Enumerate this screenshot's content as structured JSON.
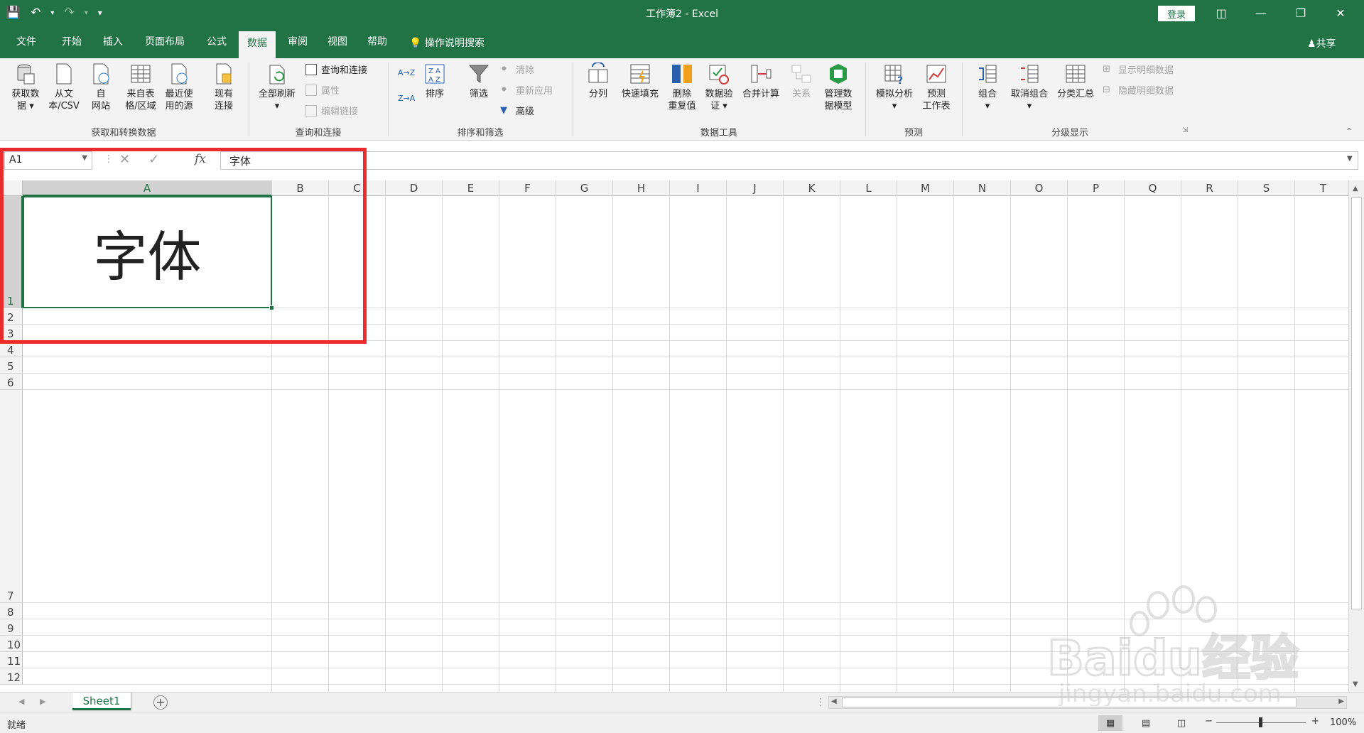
{
  "window": {
    "title": "工作簿2  -  Excel",
    "login_label": "登录",
    "share_label": "共享"
  },
  "tabs": [
    "文件",
    "开始",
    "插入",
    "页面布局",
    "公式",
    "数据",
    "审阅",
    "视图",
    "帮助"
  ],
  "tellme": "操作说明搜索",
  "ribbon": {
    "get_data": "获取数\n据 ▾",
    "from_text": "从文\n本/CSV",
    "from_web": "自\n网站",
    "from_table": "来自表\n格/区域",
    "recent_sources": "最近使\n用的源",
    "existing_conn": "现有\n连接",
    "group1": "获取和转换数据",
    "refresh_all": "全部刷新\n▾",
    "queries_conn": "查询和连接",
    "properties": "属性",
    "edit_links": "编辑链接",
    "group2": "查询和连接",
    "sort_az": "A→Z",
    "sort_za": "Z→A",
    "sort": "排序",
    "filter": "筛选",
    "clear": "清除",
    "reapply": "重新应用",
    "advanced": "高级",
    "group3": "排序和筛选",
    "text_to_col": "分列",
    "flash_fill": "快速填充",
    "remove_dup": "删除\n重复值",
    "validation": "数据验\n证 ▾",
    "consolidate": "合并计算",
    "relations": "关系",
    "manage_model": "管理数\n据模型",
    "group4": "数据工具",
    "what_if": "模拟分析\n▾",
    "forecast": "预测\n工作表",
    "group5": "预测",
    "group_btn": "组合\n▾",
    "ungroup": "取消组合\n▾",
    "subtotal": "分类汇总",
    "show_detail": "显示明细数据",
    "hide_detail": "隐藏明细数据",
    "group6": "分级显示"
  },
  "formula_bar": {
    "name_box": "A1",
    "fx": "fx",
    "content": "字体"
  },
  "columns": [
    "A",
    "B",
    "C",
    "D",
    "E",
    "F",
    "G",
    "H",
    "I",
    "J",
    "K",
    "L",
    "M",
    "N",
    "O",
    "P",
    "Q",
    "R",
    "S",
    "T"
  ],
  "rows": [
    "1",
    "2",
    "3",
    "4",
    "5",
    "6",
    "7",
    "8",
    "9",
    "10",
    "11",
    "12"
  ],
  "cell_a1": "字体",
  "sheet_tab": "Sheet1",
  "status": "就绪",
  "zoom": "100%",
  "watermark": {
    "brand": "Baidu经验",
    "url": "jingyan.baidu.com"
  },
  "colors": {
    "excel_green": "#217346",
    "highlight_red": "#ec2c2c"
  }
}
